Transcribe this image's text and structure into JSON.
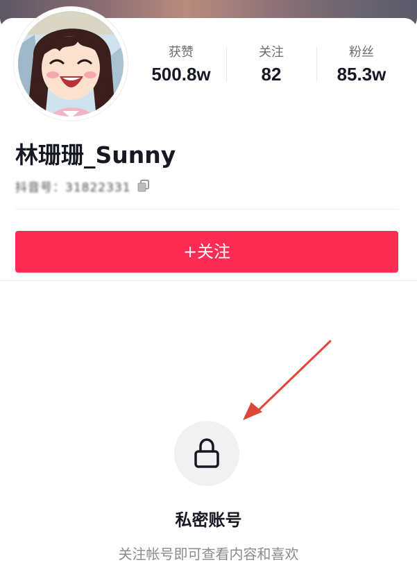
{
  "profile": {
    "name": "林珊珊_Sunny",
    "douyin_id": "抖音号：31822331"
  },
  "stats": [
    {
      "label": "获赞",
      "value": "500.8w"
    },
    {
      "label": "关注",
      "value": "82"
    },
    {
      "label": "粉丝",
      "value": "85.3w"
    }
  ],
  "actions": {
    "follow_label": "+关注"
  },
  "private_notice": {
    "title": "私密账号",
    "description": "关注帐号即可查看内容和喜欢"
  },
  "colors": {
    "accent": "#fe2c55",
    "annotation_arrow": "#e0453a"
  },
  "icons": [
    "copy-icon",
    "lock-icon"
  ]
}
